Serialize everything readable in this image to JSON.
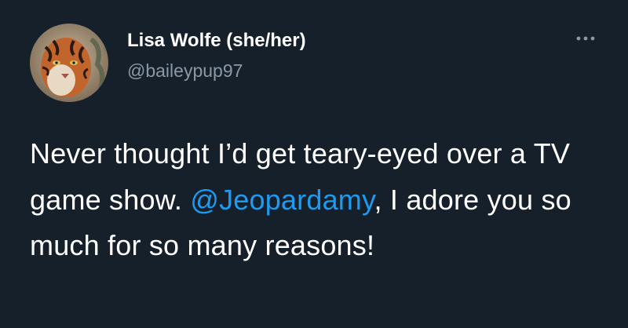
{
  "tweet": {
    "author": {
      "display_name": "Lisa Wolfe (she/her)",
      "handle": "@baileypup97",
      "avatar_icon": "tiger-avatar"
    },
    "more_icon": "more-options-icon",
    "text": {
      "part1": "Never thought I’d get teary-eyed over a TV game show. ",
      "mention": "@Jeopardamy",
      "part2": ", I adore you so much for so many reasons!"
    }
  },
  "colors": {
    "background": "#15202b",
    "text": "#ffffff",
    "secondary": "#8b98a5",
    "link": "#1d9bf0"
  }
}
